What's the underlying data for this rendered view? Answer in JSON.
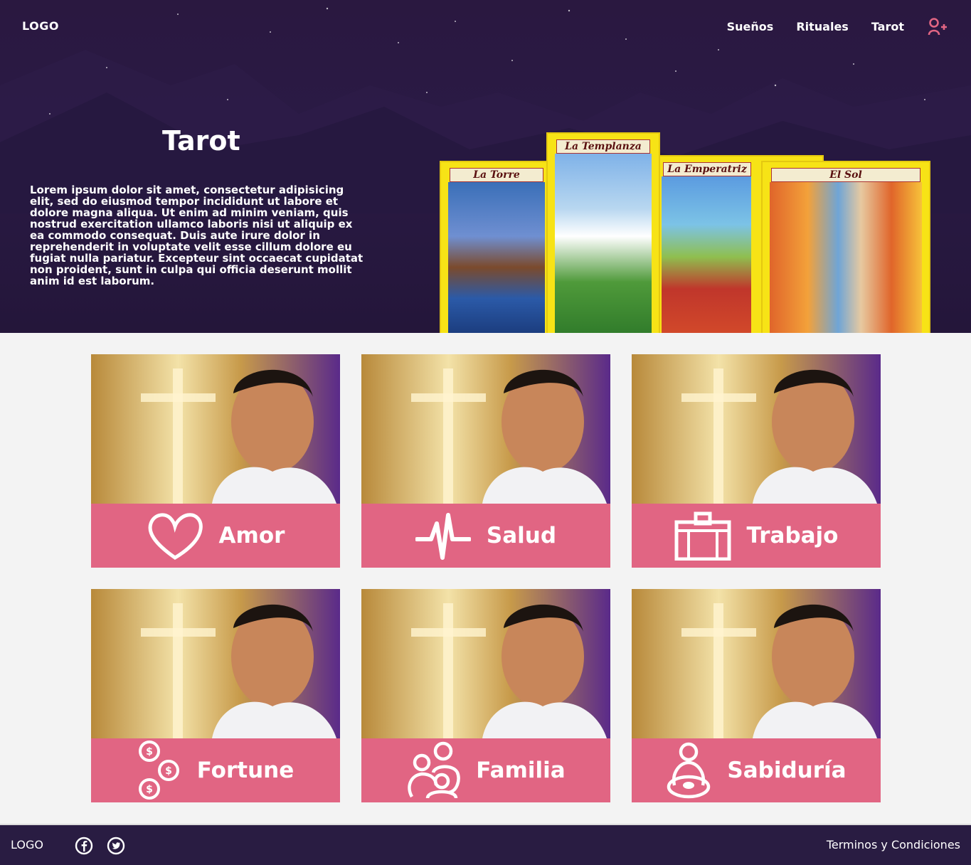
{
  "header": {
    "logo": "LOGO",
    "nav": [
      {
        "label": "Sueños"
      },
      {
        "label": "Rituales"
      },
      {
        "label": "Tarot"
      }
    ],
    "user_icon": "user-plus-icon",
    "accent": "#e16583"
  },
  "hero": {
    "title": "Tarot",
    "text": "Lorem ipsum dolor sit amet, consectetur adipisicing elit, sed do eiusmod tempor incididunt ut labore et dolore magna aliqua. Ut enim ad minim veniam, quis nostrud exercitation ullamco laboris nisi ut aliquip ex ea commodo consequat. Duis aute irure dolor in reprehenderit in voluptate velit esse cillum dolore eu fugiat nulla pariatur. Excepteur sint occaecat cupidatat non proident, sunt in culpa qui officia deserunt mollit anim id est laborum.",
    "cards": [
      {
        "name": "La Torre"
      },
      {
        "name": "La Templanza"
      },
      {
        "name": "La Emperatriz"
      },
      {
        "name": "El Sol"
      }
    ]
  },
  "categories": [
    {
      "label": "Amor",
      "icon": "heart-icon"
    },
    {
      "label": "Salud",
      "icon": "heartbeat-icon"
    },
    {
      "label": "Trabajo",
      "icon": "briefcase-icon"
    },
    {
      "label": "Fortune",
      "icon": "coins-icon"
    },
    {
      "label": "Familia",
      "icon": "family-icon"
    },
    {
      "label": "Sabiduría",
      "icon": "meditation-icon"
    }
  ],
  "footer": {
    "logo": "LOGO",
    "social": [
      "facebook-icon",
      "twitter-icon"
    ],
    "terms": "Terminos y Condiciones"
  }
}
